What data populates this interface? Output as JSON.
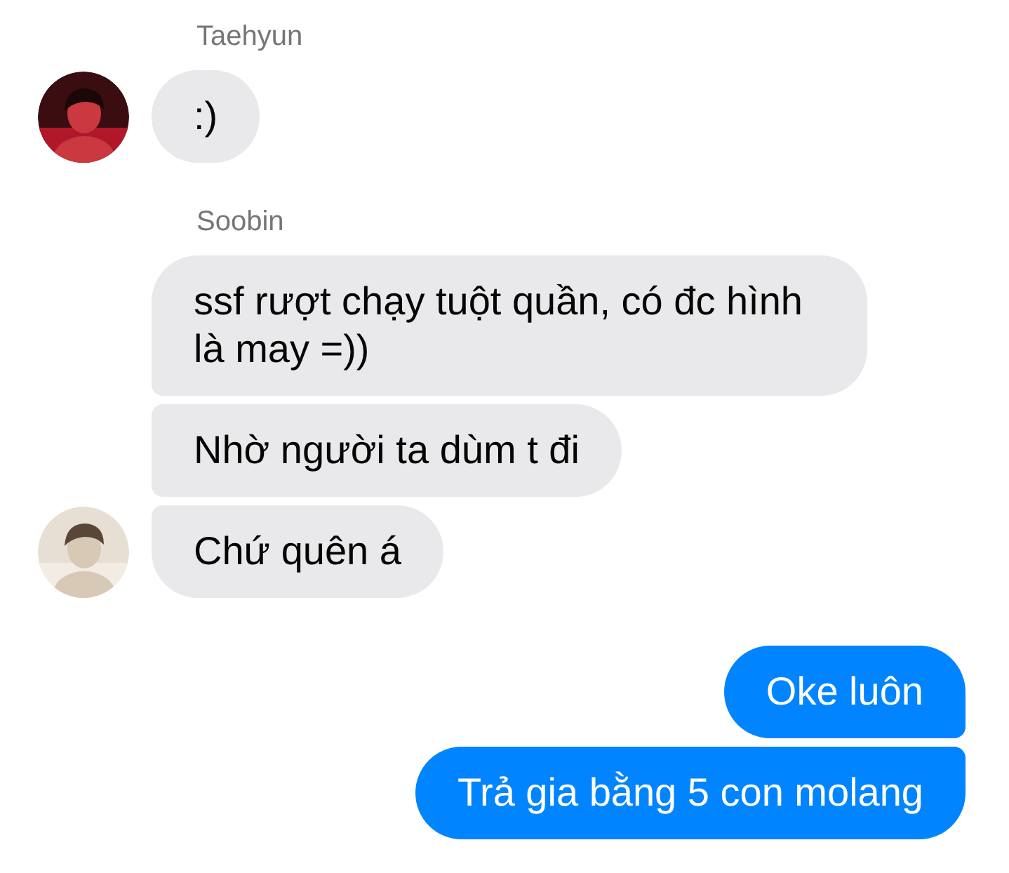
{
  "groups": [
    {
      "kind": "received",
      "sender": "Taehyun",
      "avatar": {
        "kind": "picture"
      },
      "messages": [
        ":)"
      ]
    },
    {
      "kind": "received",
      "sender": "Soobin",
      "avatar": {
        "kind": "picture"
      },
      "messages": [
        "ssf rượt chạy tuột quần, có đc hình là may =))",
        "Nhờ người ta dùm t đi",
        "Chứ quên á"
      ]
    },
    {
      "kind": "sent",
      "messages": [
        "Oke luôn",
        "Trả gia bằng 5 con molang"
      ]
    }
  ]
}
